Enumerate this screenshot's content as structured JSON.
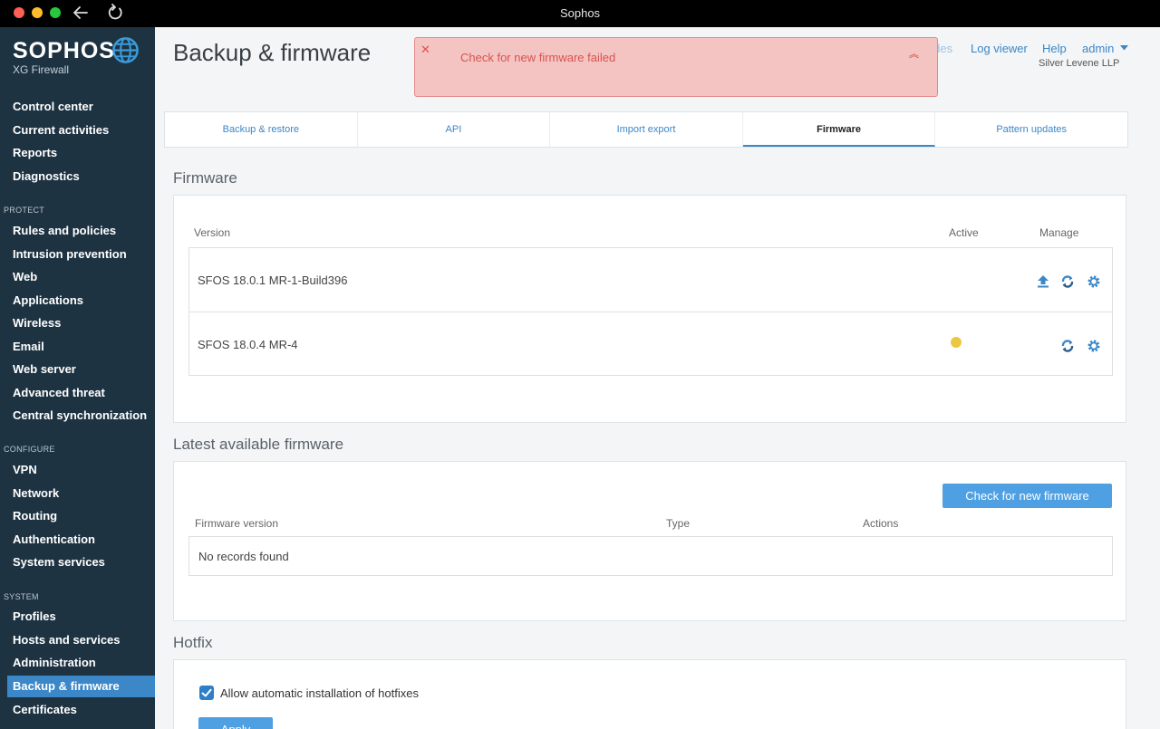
{
  "window": {
    "title": "Sophos"
  },
  "sidebar": {
    "brand": "SOPHOS",
    "product": "XG Firewall",
    "top_items": [
      "Control center",
      "Current activities",
      "Reports",
      "Diagnostics"
    ],
    "protect_label": "PROTECT",
    "protect_items": [
      "Rules and policies",
      "Intrusion prevention",
      "Web",
      "Applications",
      "Wireless",
      "Email",
      "Web server",
      "Advanced threat",
      "Central synchronization"
    ],
    "configure_label": "CONFIGURE",
    "configure_items": [
      "VPN",
      "Network",
      "Routing",
      "Authentication",
      "System services"
    ],
    "system_label": "SYSTEM",
    "system_items": [
      "Profiles",
      "Hosts and services",
      "Administration",
      "Backup & firmware",
      "Certificates"
    ],
    "active_item": "Backup & firmware"
  },
  "header": {
    "page_title": "Backup & firmware",
    "howto": "How-to guides",
    "log_viewer": "Log viewer",
    "help": "Help",
    "user": "admin",
    "org": "Silver Levene LLP"
  },
  "toast": {
    "message": "Check for new firmware failed"
  },
  "tabs": [
    "Backup & restore",
    "API",
    "Import export",
    "Firmware",
    "Pattern updates"
  ],
  "active_tab": "Firmware",
  "firmware": {
    "title": "Firmware",
    "col_version": "Version",
    "col_active": "Active",
    "col_manage": "Manage",
    "rows": [
      {
        "version": "SFOS 18.0.1 MR-1-Build396",
        "active": false
      },
      {
        "version": "SFOS 18.0.4 MR-4",
        "active": true
      }
    ]
  },
  "latest": {
    "title": "Latest available firmware",
    "check_button": "Check for new firmware",
    "col_version": "Firmware version",
    "col_type": "Type",
    "col_actions": "Actions",
    "empty": "No records found"
  },
  "hotfix": {
    "title": "Hotfix",
    "checkbox_label": "Allow automatic installation of hotfixes",
    "checked": true,
    "apply_button": "Apply"
  },
  "colors": {
    "accent": "#3b87c8",
    "sidebar": "#1e3342",
    "error_bg": "#f4c4c2",
    "error_text": "#d9534f",
    "active_dot": "#ebc742"
  }
}
